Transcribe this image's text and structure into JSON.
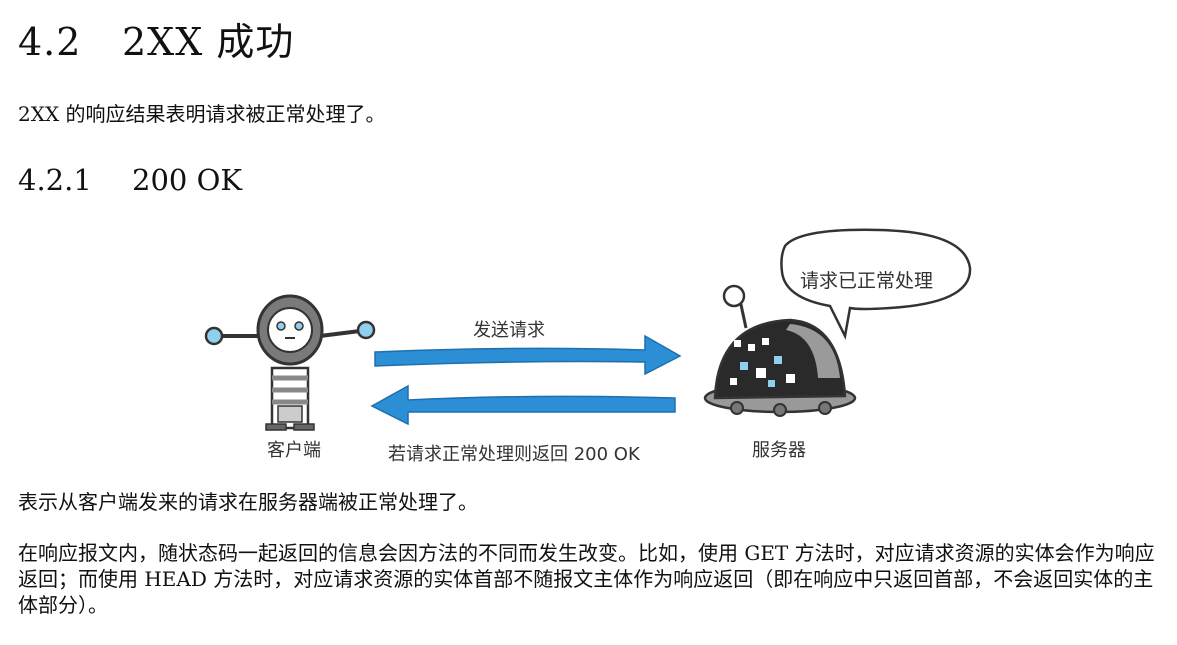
{
  "section": {
    "number": "4.2",
    "title": "2XX 成功"
  },
  "intro": "2XX 的响应结果表明请求被正常处理了。",
  "subsection": {
    "number": "4.2.1",
    "title": "200 OK"
  },
  "figure": {
    "client_label": "客户端",
    "server_label": "服务器",
    "request_arrow_label": "发送请求",
    "response_arrow_label": "若请求正常处理则返回 200 OK",
    "speech_bubble": "请求已正常处理",
    "arrow_color": "#2c8fd6"
  },
  "caption": "表示从客户端发来的请求在服务器端被正常处理了。",
  "paragraph": "在响应报文内，随状态码一起返回的信息会因方法的不同而发生改变。比如，使用 GET 方法时，对应请求资源的实体会作为响应返回；而使用 HEAD 方法时，对应请求资源的实体首部不随报文主体作为响应返回（即在响应中只返回首部，不会返回实体的主体部分）。"
}
